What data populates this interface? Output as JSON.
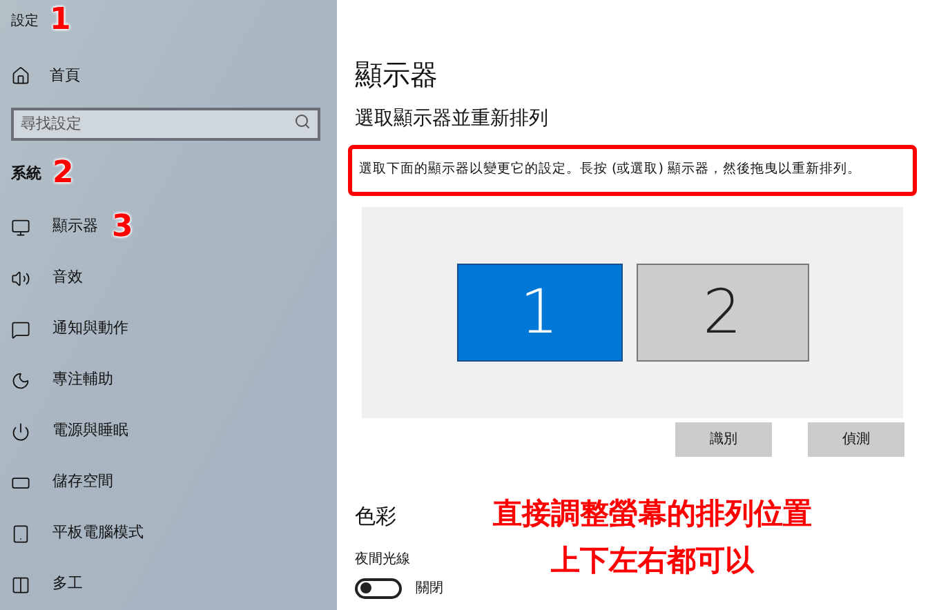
{
  "sidebar": {
    "title": "設定",
    "title_note": "1",
    "home": "首頁",
    "search": {
      "placeholder": "尋找設定"
    },
    "section": "系統",
    "section_note": "2",
    "items": [
      {
        "label": "顯示器",
        "note": "3"
      },
      {
        "label": "音效"
      },
      {
        "label": "通知與動作"
      },
      {
        "label": "專注輔助"
      },
      {
        "label": "電源與睡眠"
      },
      {
        "label": "儲存空間"
      },
      {
        "label": "平板電腦模式"
      },
      {
        "label": "多工"
      }
    ]
  },
  "main": {
    "title": "顯示器",
    "subtitle": "選取顯示器並重新排列",
    "hint": "選取下面的顯示器以變更它的設定。長按 (或選取) 顯示器，然後拖曳以重新排列。",
    "monitors": [
      {
        "label": "1",
        "selected": true
      },
      {
        "label": "2",
        "selected": false
      }
    ],
    "buttons": [
      "識別",
      "偵測"
    ],
    "color_heading": "色彩",
    "night_light": {
      "label": "夜間光線",
      "on": false,
      "state": "關閉"
    }
  },
  "overlay": [
    "直接調整螢幕的排列位置",
    "上下左右都可以"
  ]
}
